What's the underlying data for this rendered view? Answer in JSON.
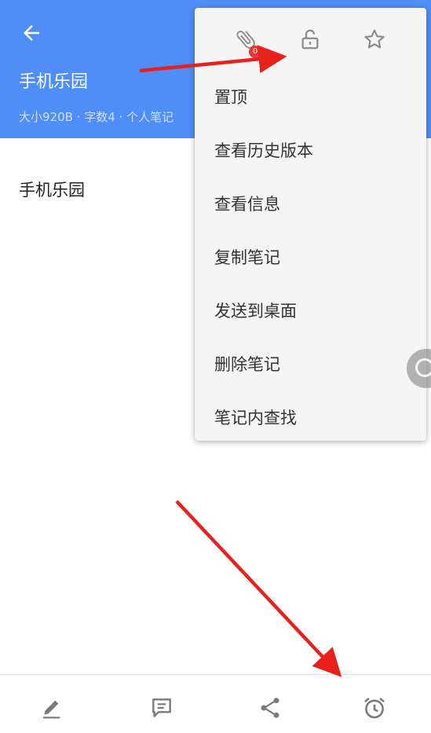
{
  "header": {
    "title": "手机乐园",
    "meta": "大小920B · 字数4 · 个人笔记",
    "background": "#4f8ef6"
  },
  "icons": {
    "back": "arrow-left-icon",
    "attachment": "paperclip-icon",
    "lock": "unlock-icon",
    "favorite": "star-icon",
    "edit": "pencil-icon",
    "comment": "comment-icon",
    "share": "share-icon",
    "reminder": "alarm-clock-icon"
  },
  "note": {
    "body": "手机乐园"
  },
  "popup": {
    "attachment_count": "0",
    "items": [
      {
        "label": "置顶"
      },
      {
        "label": "查看历史版本"
      },
      {
        "label": "查看信息"
      },
      {
        "label": "复制笔记"
      },
      {
        "label": "发送到桌面"
      },
      {
        "label": "删除笔记"
      },
      {
        "label": "笔记内查找"
      }
    ]
  },
  "annotation_color": "#e8211c"
}
